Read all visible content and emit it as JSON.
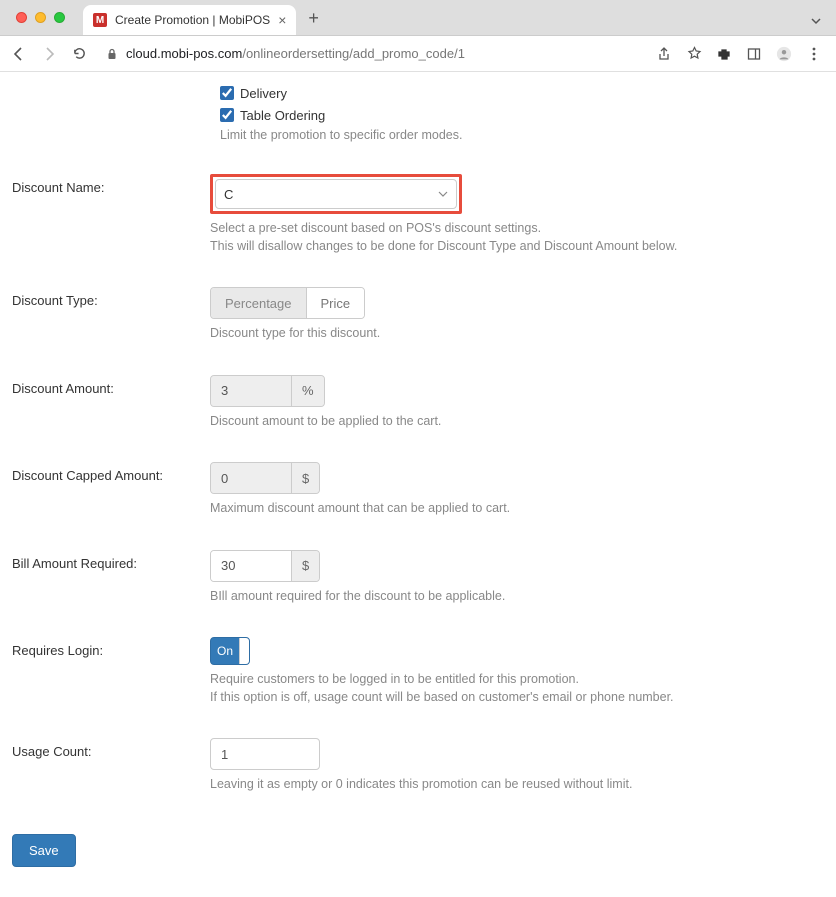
{
  "browser": {
    "tab_title": "Create Promotion | MobiPOS",
    "url_host": "cloud.mobi-pos.com",
    "url_path": "/onlineordersetting/add_promo_code/1"
  },
  "order_modes": {
    "delivery_label": "Delivery",
    "table_ordering_label": "Table Ordering",
    "help": "Limit the promotion to specific order modes."
  },
  "discount_name": {
    "label": "Discount Name:",
    "value": "C",
    "help_line1": "Select a pre-set discount based on POS's discount settings.",
    "help_line2": "This will disallow changes to be done for Discount Type and Discount Amount below."
  },
  "discount_type": {
    "label": "Discount Type:",
    "percentage": "Percentage",
    "price": "Price",
    "help": "Discount type for this discount."
  },
  "discount_amount": {
    "label": "Discount Amount:",
    "value": "3",
    "suffix": "%",
    "help": "Discount amount to be applied to the cart."
  },
  "capped": {
    "label": "Discount Capped Amount:",
    "value": "0",
    "suffix": "$",
    "help": "Maximum discount amount that can be applied to cart."
  },
  "bill_required": {
    "label": "Bill Amount Required:",
    "value": "30",
    "suffix": "$",
    "help": "BIll amount required for the discount to be applicable."
  },
  "requires_login": {
    "label": "Requires Login:",
    "toggle_text": "On",
    "help_line1": "Require customers to be logged in to be entitled for this promotion.",
    "help_line2": "If this option is off, usage count will be based on customer's email or phone number."
  },
  "usage_count": {
    "label": "Usage Count:",
    "value": "1",
    "help": "Leaving it as empty or 0 indicates this promotion can be reused without limit."
  },
  "save_label": "Save"
}
